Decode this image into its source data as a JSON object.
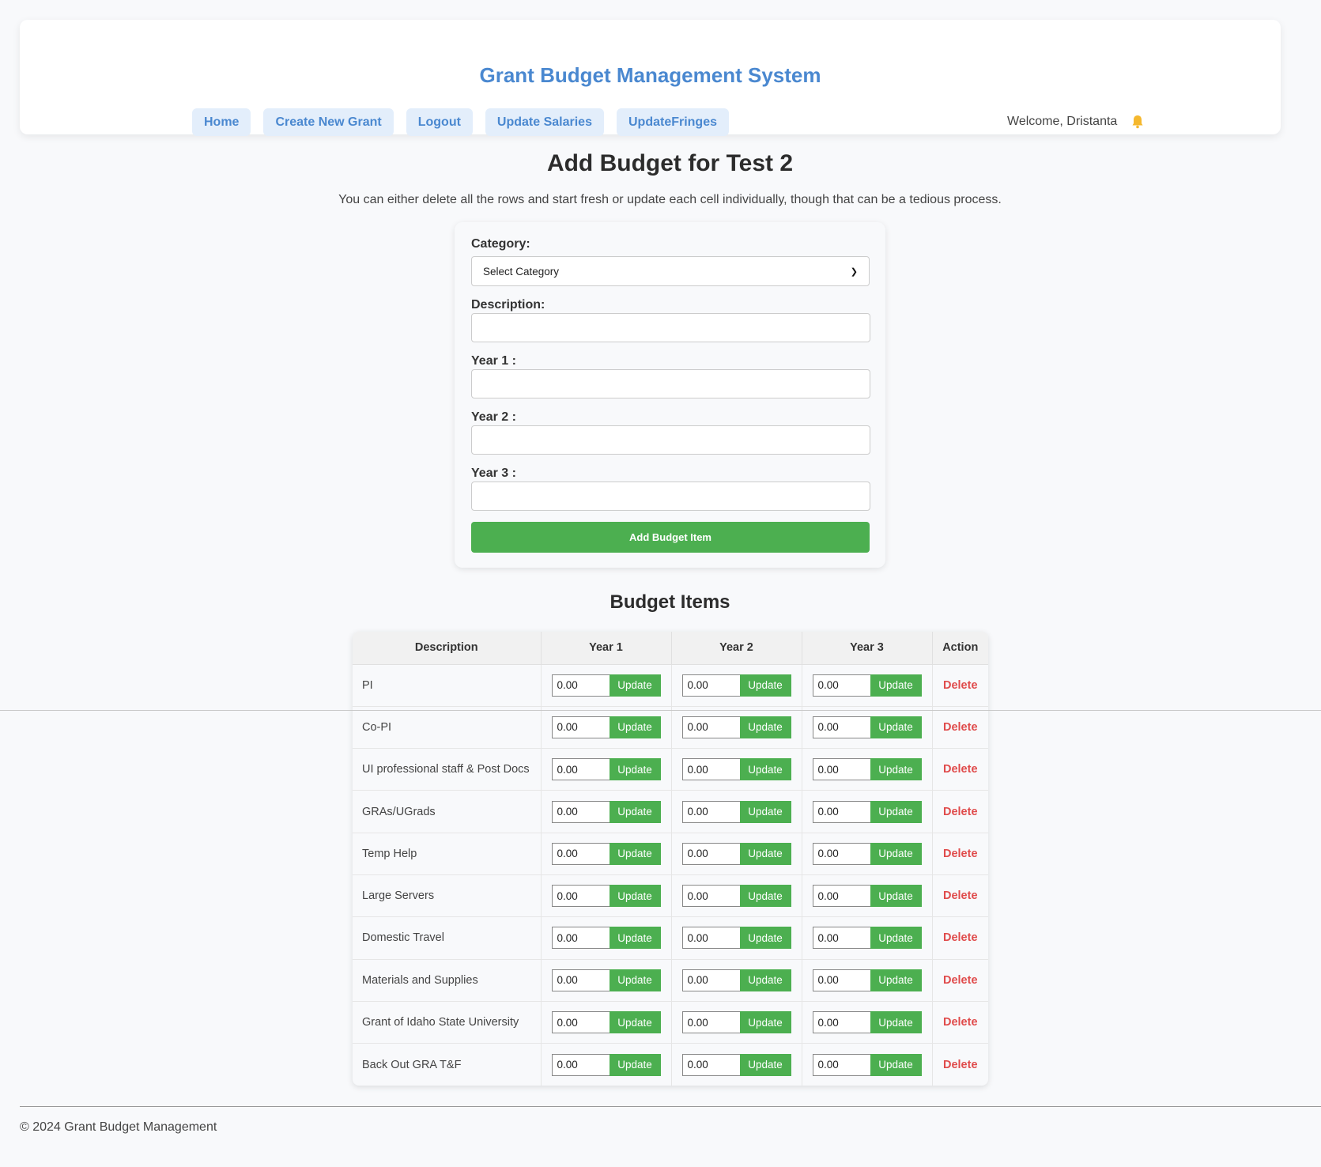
{
  "header": {
    "title": "Grant Budget Management System",
    "nav": [
      {
        "label": "Home"
      },
      {
        "label": "Create New Grant"
      },
      {
        "label": "Logout"
      },
      {
        "label": "Update Salaries"
      },
      {
        "label": "UpdateFringes"
      }
    ],
    "welcome": "Welcome, Dristanta",
    "notification_icon": "bell-icon"
  },
  "page": {
    "title": "Add Budget for Test 2",
    "subtitle": "You can either delete all the rows and start fresh or update each cell individually, though that can be a tedious process."
  },
  "form": {
    "category_label": "Category:",
    "category_selected": "Select Category",
    "description_label": "Description:",
    "description_value": "",
    "year1_label": "Year 1 :",
    "year1_value": "",
    "year2_label": "Year 2 :",
    "year2_value": "",
    "year3_label": "Year 3 :",
    "year3_value": "",
    "submit_label": "Add Budget Item"
  },
  "budget_items": {
    "title": "Budget Items",
    "columns": [
      "Description",
      "Year 1",
      "Year 2",
      "Year 3",
      "Action"
    ],
    "update_label": "Update",
    "delete_label": "Delete",
    "rows": [
      {
        "description": "PI",
        "year1": "0.00",
        "year2": "0.00",
        "year3": "0.00"
      },
      {
        "description": "Co-PI",
        "year1": "0.00",
        "year2": "0.00",
        "year3": "0.00"
      },
      {
        "description": "UI professional staff & Post Docs",
        "year1": "0.00",
        "year2": "0.00",
        "year3": "0.00"
      },
      {
        "description": "GRAs/UGrads",
        "year1": "0.00",
        "year2": "0.00",
        "year3": "0.00"
      },
      {
        "description": "Temp Help",
        "year1": "0.00",
        "year2": "0.00",
        "year3": "0.00"
      },
      {
        "description": "Large Servers",
        "year1": "0.00",
        "year2": "0.00",
        "year3": "0.00"
      },
      {
        "description": "Domestic Travel",
        "year1": "0.00",
        "year2": "0.00",
        "year3": "0.00"
      },
      {
        "description": "Materials and Supplies",
        "year1": "0.00",
        "year2": "0.00",
        "year3": "0.00"
      },
      {
        "description": "Grant of Idaho State University",
        "year1": "0.00",
        "year2": "0.00",
        "year3": "0.00"
      },
      {
        "description": "Back Out GRA T&F",
        "year1": "0.00",
        "year2": "0.00",
        "year3": "0.00"
      }
    ]
  },
  "footer": {
    "text": "© 2024 Grant Budget Management"
  },
  "colors": {
    "brand_blue": "#4a88d0",
    "nav_bg": "#e3eefb",
    "success_green": "#4caf50",
    "danger_red": "#e04b4b",
    "bell_yellow": "#f5b82e"
  }
}
